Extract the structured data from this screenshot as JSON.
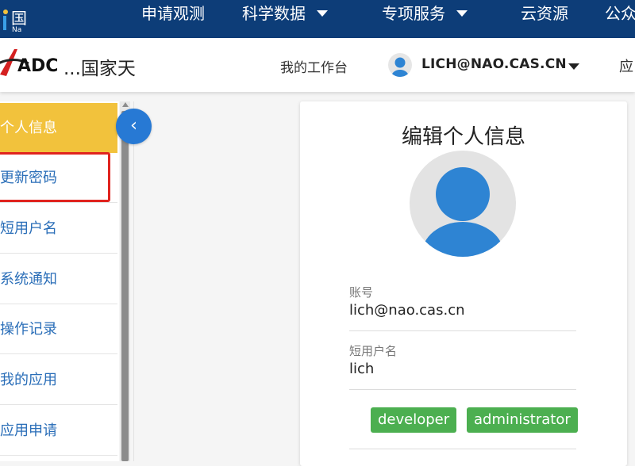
{
  "topnav": {
    "logo_char": "国",
    "logo_sub": "Na",
    "items": [
      {
        "label": "申请观测"
      },
      {
        "label": "科学数据"
      },
      {
        "label": "专项服务"
      },
      {
        "label": "云资源"
      },
      {
        "label": "公众"
      }
    ]
  },
  "header": {
    "brand_logo_text": "ADC",
    "brand_text": "...国家天",
    "workspace_label": "我的工作台",
    "user_email": "LICH@NAO.CAS.CN",
    "app_label": "应"
  },
  "sidebar": {
    "items": [
      {
        "label": "个人信息"
      },
      {
        "label": "更新密码"
      },
      {
        "label": "短用户名"
      },
      {
        "label": "系统通知"
      },
      {
        "label": "操作记录"
      },
      {
        "label": "我的应用"
      },
      {
        "label": "应用申请"
      }
    ],
    "collapse_glyph": "‹"
  },
  "card": {
    "title": "编辑个人信息",
    "account_label": "账号",
    "account_value": "lich@nao.cas.cn",
    "short_name_label": "短用户名",
    "short_name_value": "lich",
    "roles": [
      "developer",
      "administrator"
    ]
  },
  "colors": {
    "nav_bg": "#0d3d78",
    "active_item": "#f2c23c",
    "link_blue": "#2a6eb8",
    "collapse_btn": "#2779d4",
    "tag_green": "#4caf50",
    "highlight_red": "#e0231e"
  }
}
